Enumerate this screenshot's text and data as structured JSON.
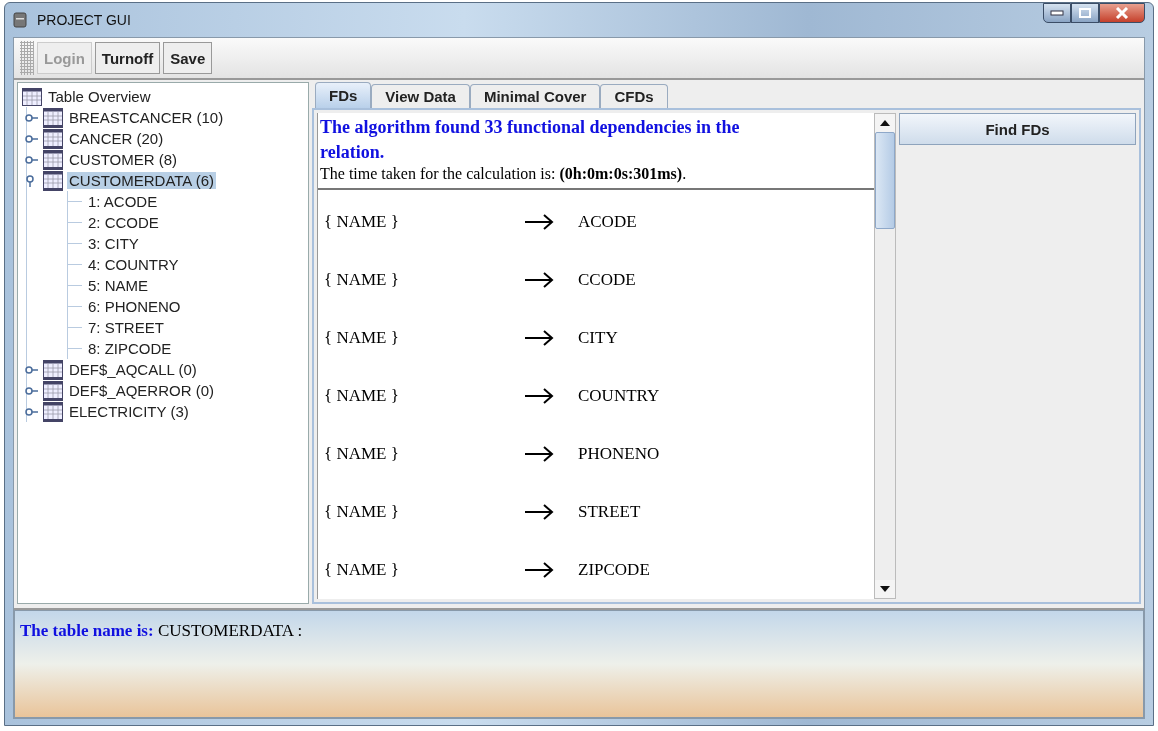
{
  "window": {
    "title": "PROJECT GUI"
  },
  "toolbar": [
    {
      "label": "Login",
      "disabled": true
    },
    {
      "label": "Turnoff",
      "disabled": false
    },
    {
      "label": "Save",
      "disabled": false
    }
  ],
  "tree": {
    "label": "Table Overview",
    "children": [
      {
        "label": "BREASTCANCER (10)",
        "expanded": false,
        "selected": false
      },
      {
        "label": "CANCER (20)",
        "expanded": false,
        "selected": false
      },
      {
        "label": "CUSTOMER (8)",
        "expanded": false,
        "selected": false
      },
      {
        "label": "CUSTOMERDATA (6)",
        "expanded": true,
        "selected": true,
        "children": [
          {
            "label": "1: ACODE"
          },
          {
            "label": "2: CCODE"
          },
          {
            "label": "3: CITY"
          },
          {
            "label": "4: COUNTRY"
          },
          {
            "label": "5: NAME"
          },
          {
            "label": "6: PHONENO"
          },
          {
            "label": "7: STREET"
          },
          {
            "label": "8: ZIPCODE"
          }
        ]
      },
      {
        "label": "DEF$_AQCALL (0)",
        "expanded": false,
        "selected": false
      },
      {
        "label": "DEF$_AQERROR (0)",
        "expanded": false,
        "selected": false
      },
      {
        "label": "ELECTRICITY (3)",
        "expanded": false,
        "selected": false
      }
    ]
  },
  "tabs": [
    {
      "label": "FDs",
      "selected": true
    },
    {
      "label": "View Data",
      "selected": false
    },
    {
      "label": "Minimal Cover",
      "selected": false
    },
    {
      "label": "CFDs",
      "selected": false
    }
  ],
  "result": {
    "heading": "The algorithm found 33 functional dependencies in the relation.",
    "time_note": "The time taken for the calculation is: **(0h:0m:0s:301ms)**."
  },
  "dependencies": [
    {
      "lhs": "{ NAME }",
      "rhs": "ACODE"
    },
    {
      "lhs": "{ NAME }",
      "rhs": "CCODE"
    },
    {
      "lhs": "{ NAME }",
      "rhs": "CITY"
    },
    {
      "lhs": "{ NAME }",
      "rhs": "COUNTRY"
    },
    {
      "lhs": "{ NAME }",
      "rhs": "PHONENO"
    },
    {
      "lhs": "{ NAME }",
      "rhs": "STREET"
    },
    {
      "lhs": "{ NAME }",
      "rhs": "ZIPCODE"
    }
  ],
  "find_button": "Find FDs",
  "status": {
    "label": "The table name is:",
    "value": "CUSTOMERDATA :"
  }
}
